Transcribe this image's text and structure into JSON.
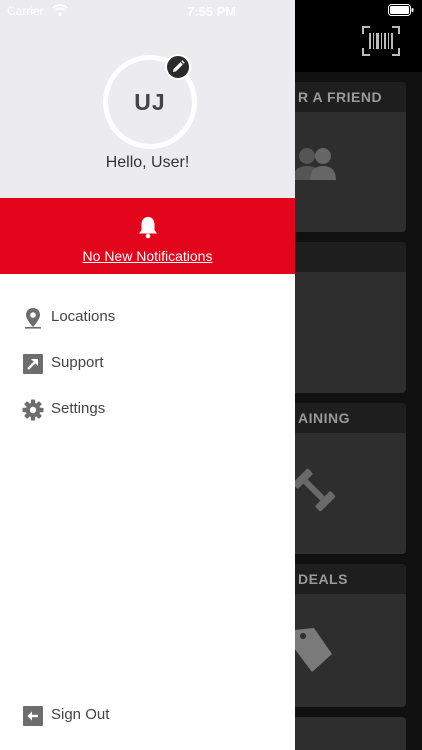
{
  "status_bar": {
    "carrier": "Carrier",
    "time": "7:55 PM"
  },
  "drawer": {
    "avatar_initials": "UJ",
    "greeting": "Hello, User!",
    "notifications": {
      "text": "No New Notifications"
    },
    "menu": [
      {
        "label": "Locations",
        "icon": "location-pin-icon"
      },
      {
        "label": "Support",
        "icon": "external-link-icon"
      },
      {
        "label": "Settings",
        "icon": "gear-icon"
      }
    ],
    "sign_out": {
      "label": "Sign Out",
      "icon": "sign-out-icon"
    }
  },
  "background_app": {
    "cards": [
      {
        "title": "R A FRIEND",
        "icon": "people-icon"
      },
      {
        "title": "",
        "icon": ""
      },
      {
        "title": "AINING",
        "icon": "dumbbell-icon"
      },
      {
        "title": "DEALS",
        "icon": "tag-icon"
      }
    ]
  },
  "colors": {
    "accent_red": "#e3051b",
    "profile_bg": "#ececee",
    "menu_text": "#444444",
    "background": "#101010"
  }
}
